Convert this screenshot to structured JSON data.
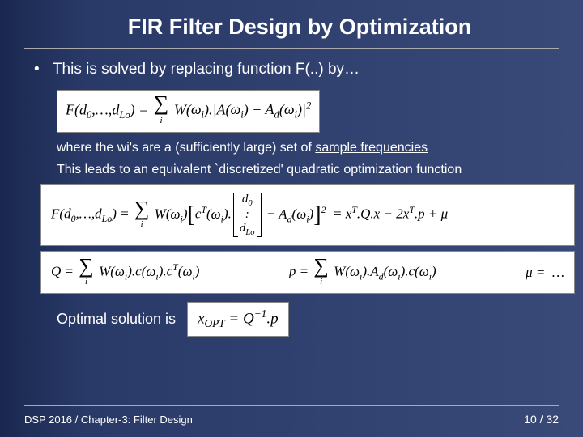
{
  "title": "FIR Filter Design by Optimization",
  "bullet_text": "This is solved by replacing function F(..) by…",
  "formula1": "F(d₀,…,d_Lo) = Σᵢ W(ωᵢ).|A(ωᵢ) − A_d(ωᵢ)|²",
  "note1_a": "where the wi's are a (sufficiently large) set of ",
  "note1_b": "sample frequencies",
  "note2": "This leads to an equivalent `discretized' quadratic optimization function",
  "formula2_lhs": "F(d₀,…,d_Lo) = ",
  "formula2_sum": "Σ",
  "formula2_sumsub": "i",
  "formula2_mid_a": "W(ωᵢ)",
  "formula2_mid_b": "cᵀ(ωᵢ).",
  "formula2_vec_top": "d₀",
  "formula2_vec_mid": ":",
  "formula2_vec_bot": "d_Lo",
  "formula2_mid_c": " − A_d(ωᵢ)",
  "formula2_rhs": " = xᵀ.Q.x − 2xᵀ.p + μ",
  "formula3_q": "Q = Σᵢ W(ωᵢ).c(ωᵢ).cᵀ(ωᵢ)",
  "formula3_p": "p = Σᵢ W(ωᵢ).A_d(ωᵢ).c(ωᵢ)",
  "formula3_mu": "μ =  …",
  "opt_label": "Optimal solution is",
  "formula4": "x_OPT = Q⁻¹.p",
  "footer_left": "DSP 2016 /  Chapter-3: Filter Design",
  "page_current": "10",
  "page_sep": " / ",
  "page_total": "32"
}
